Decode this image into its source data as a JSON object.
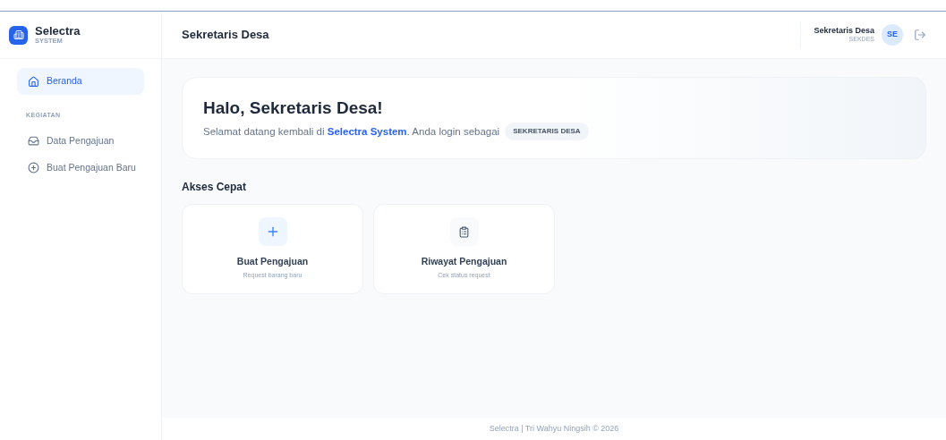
{
  "brand": {
    "name": "Selectra",
    "tagline": "SYSTEM"
  },
  "sidebar": {
    "items": [
      {
        "label": "Beranda",
        "kind": "home",
        "selected": true
      }
    ],
    "section": "KEGIATAN",
    "section_items": [
      {
        "label": "Data Pengajuan",
        "kind": "inbox",
        "selected": false
      },
      {
        "label": "Buat Pengajuan Baru",
        "kind": "plus-circle",
        "selected": false
      }
    ]
  },
  "header": {
    "title": "Sekretaris Desa",
    "user": {
      "name": "Sekretaris Desa",
      "role": "SEKDES",
      "initials": "SE"
    }
  },
  "welcome": {
    "title": "Halo, Sekretaris Desa!",
    "text": "Selamat datang kembali di **Selectra System**. Anda login sebagai",
    "badge": "SEKRETARIS DESA"
  },
  "quick_access": {
    "title": "Akses Cepat",
    "cards": [
      {
        "kind": "plus",
        "title": "Buat Pengajuan",
        "subtitle": "Request barang baru"
      },
      {
        "kind": "clipboard",
        "title": "Riwayat Pengajuan",
        "subtitle": "Cek status request"
      }
    ]
  },
  "footer": "Selectra | Tri Wahyu Ningsih © 2026"
}
